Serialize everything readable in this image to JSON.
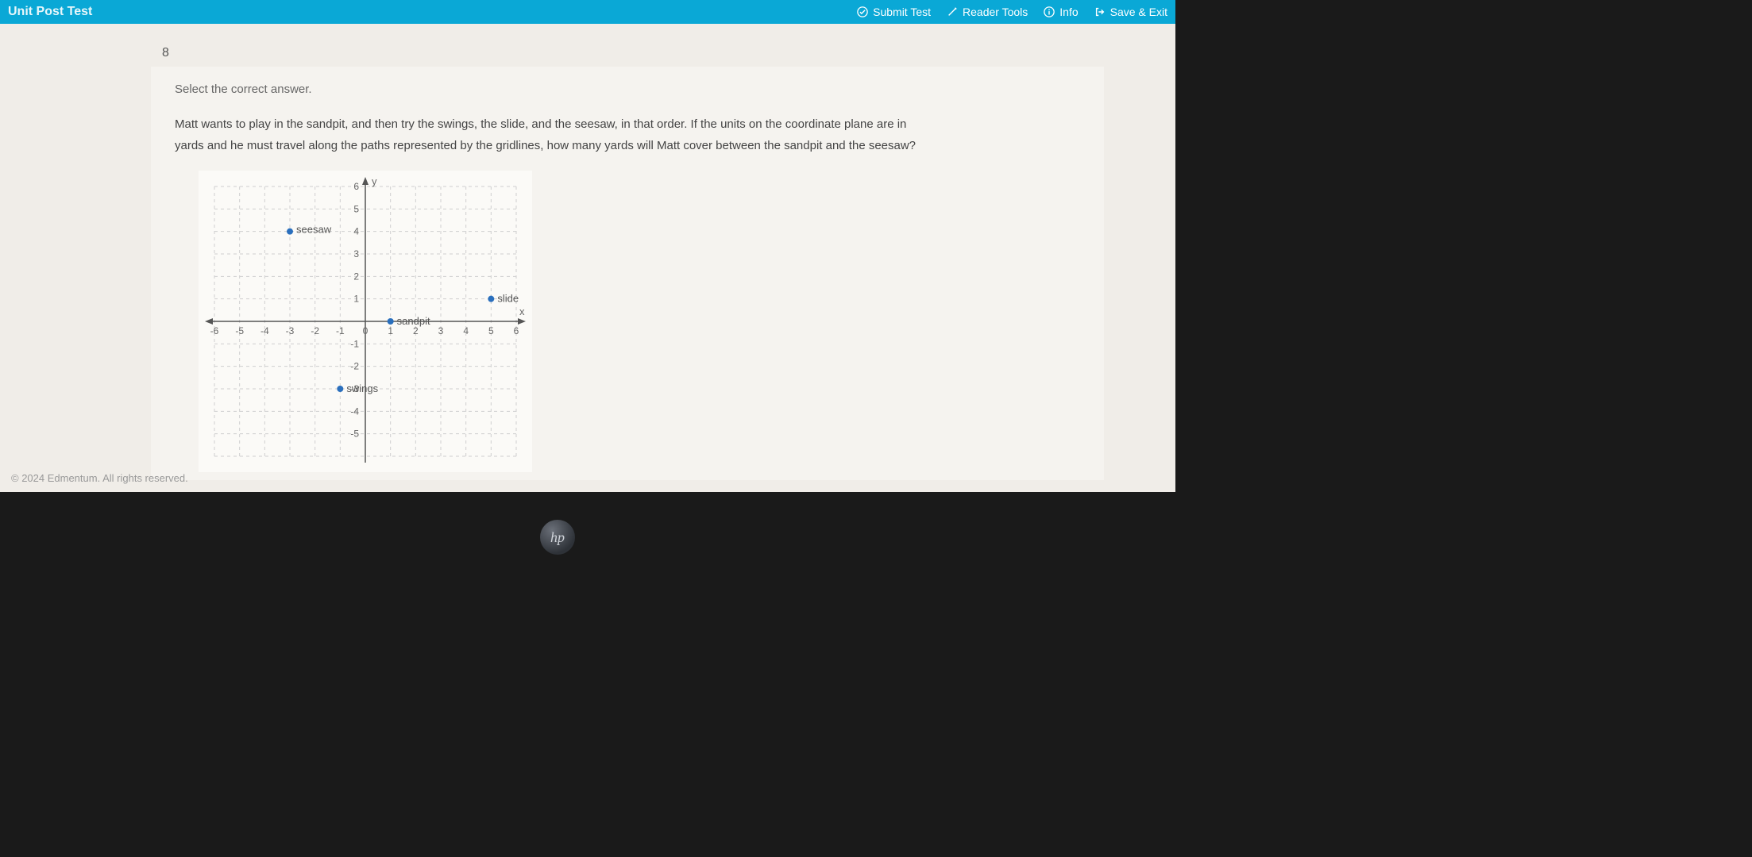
{
  "topbar": {
    "title": "Unit Post Test",
    "submit": "Submit Test",
    "reader": "Reader Tools",
    "info": "Info",
    "save": "Save & Exit"
  },
  "question_number": "8",
  "instruction": "Select the correct answer.",
  "question_text": "Matt wants to play in the sandpit, and then try the swings, the slide, and the seesaw, in that order. If the units on the coordinate plane are in yards and he must travel along the paths represented by the gridlines, how many yards will Matt cover between the sandpit and the seesaw?",
  "footer": "© 2024 Edmentum. All rights reserved.",
  "logo": "hp",
  "chart_data": {
    "type": "scatter",
    "xlabel": "x",
    "ylabel": "y",
    "xlim": [
      -6,
      6
    ],
    "ylim": [
      -6,
      6
    ],
    "x_ticks": [
      -6,
      -5,
      -4,
      -3,
      -2,
      -1,
      0,
      1,
      2,
      3,
      4,
      5,
      6
    ],
    "y_ticks": [
      -5,
      -4,
      -3,
      -2,
      -1,
      0,
      1,
      2,
      3,
      4,
      5,
      6
    ],
    "points": [
      {
        "name": "seesaw",
        "x": -3,
        "y": 4,
        "label_dx": 8,
        "label_dy": -8
      },
      {
        "name": "sandpit",
        "x": 1,
        "y": 0,
        "label_dx": 8,
        "label_dy": -6
      },
      {
        "name": "slide",
        "x": 5,
        "y": 1,
        "label_dx": 8,
        "label_dy": -6
      },
      {
        "name": "swings",
        "x": -1,
        "y": -3,
        "label_dx": 8,
        "label_dy": -6
      }
    ]
  }
}
